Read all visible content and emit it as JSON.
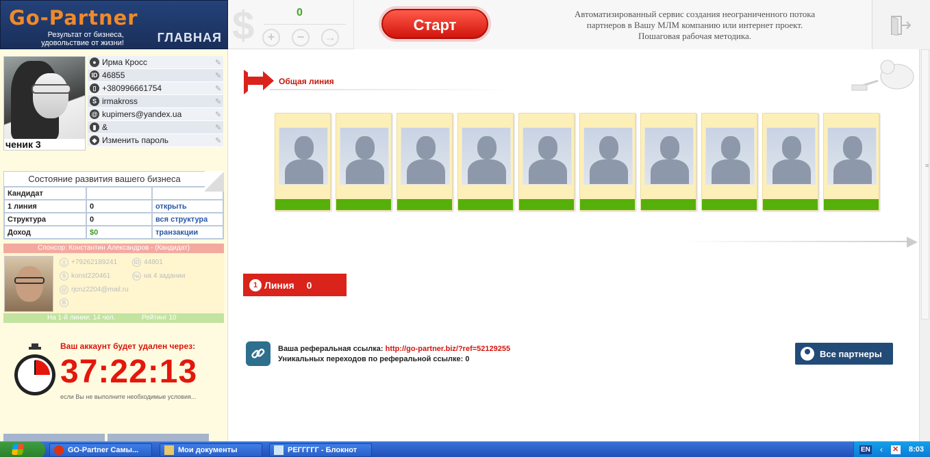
{
  "header": {
    "logo_name": "Go-Partner",
    "slogan_line1": "Результат от бизнеса,",
    "slogan_line2": "удовольствие от жизни!",
    "home_label": "ГЛАВНАЯ",
    "balance_value": "0",
    "start_label": "Старт",
    "info_line1": "Автоматизированный сервис создания неограниченного потока",
    "info_line2": "партнеров в Вашу МЛМ компанию или интернет проект.",
    "info_line3": "Пошаговая рабочая методика."
  },
  "profile": {
    "caption": "ченик 3",
    "fields": [
      {
        "icon": "user-icon",
        "value": "Ирма Кросс"
      },
      {
        "icon": "id-icon",
        "value": "46855"
      },
      {
        "icon": "phone-icon",
        "value": "+380996661754"
      },
      {
        "icon": "skype-icon",
        "value": "irmakross"
      },
      {
        "icon": "email-icon",
        "value": "kupimers@yandex.ua"
      },
      {
        "icon": "wallet-icon",
        "value": "&"
      },
      {
        "icon": "shield-icon",
        "value": "Изменить пароль"
      }
    ]
  },
  "status": {
    "title": "Состояние развития вашего бизнеса",
    "rows": [
      {
        "label": "Кандидат",
        "value": "",
        "action": ""
      },
      {
        "label": "1 линия",
        "value": "0",
        "action": "открыть"
      },
      {
        "label": "Структура",
        "value": "0",
        "action": "вся структура"
      },
      {
        "label": "Доход",
        "value": "$0",
        "action": "транзакции"
      }
    ]
  },
  "sponsor": {
    "title": "Спонсор: Константин Александров - (Кандидат)",
    "phone": "+79262189241",
    "id": "44801",
    "skype": "konst220461",
    "task": "на 4 задании",
    "email": "rjcnz2204@mail.ru",
    "rank_bar_line1": "На 1-й линии: 14 чел.",
    "rank_bar_line2": "Рейтинг 10"
  },
  "countdown": {
    "warning": "Ваш аккаунт будет удален через:",
    "time": "37:22:13",
    "note": "если Вы не выполните необходимые условия..."
  },
  "main": {
    "section_title": "Общая линия",
    "partner_slots": 10,
    "line_label": "Линия",
    "line_count": "0",
    "ref_label": "Ваша реферальная ссылка:",
    "ref_link": "http://go-partner.biz/?ref=52129255",
    "ref_clicks_label": "Уникальных переходов по реферальной ссылке:",
    "ref_clicks": "0",
    "all_partners_label": "Все партнеры"
  },
  "taskbar": {
    "items": [
      {
        "label": "GO-Partner Самы...",
        "icon": "opera-icon"
      },
      {
        "label": "Мои документы",
        "icon": "folder-icon"
      },
      {
        "label": "РЕГГГГГ - Блокнот",
        "icon": "notepad-icon"
      }
    ],
    "lang": "EN",
    "clock": "8:03"
  }
}
